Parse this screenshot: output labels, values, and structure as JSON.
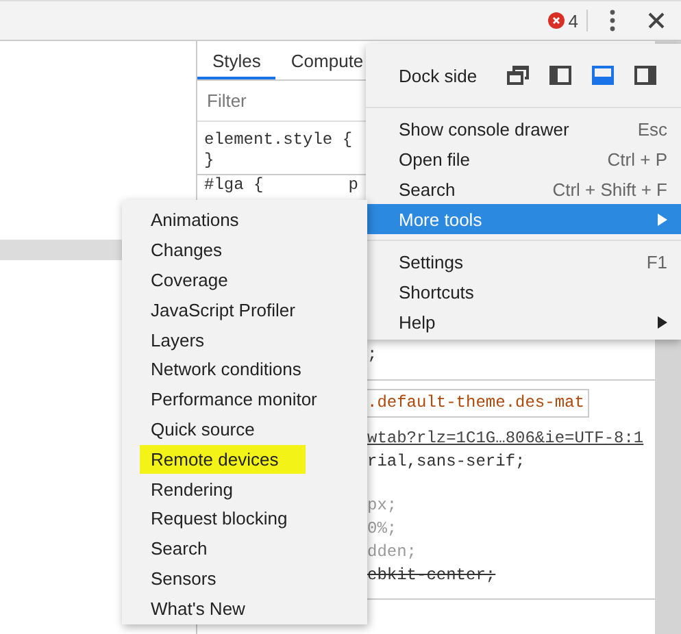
{
  "toolbar": {
    "error_count": "4"
  },
  "styles_panel": {
    "tabs": [
      {
        "label": "Styles",
        "selected": true
      },
      {
        "label": "Compute",
        "selected": false
      }
    ],
    "filter": {
      "placeholder": "Filter"
    },
    "element_style": [
      "element.style {",
      "}"
    ],
    "rule_head": "#lga {",
    "rule_fragment": "p",
    "rule_tail": ";",
    "selector": ".default-theme.des-mat",
    "source_link": "wtab?rlz=1C1G…806&ie=UTF-8:1",
    "declaration": "rial,sans-serif;",
    "overridden_lines": [
      {
        "text": "px;",
        "struck": false
      },
      {
        "text": "0%;",
        "struck": false
      },
      {
        "text": "dden;",
        "struck": false
      },
      {
        "text": "ebkit-center;",
        "struck": true
      }
    ]
  },
  "main_menu": {
    "dock_side": {
      "label": "Dock side",
      "options": [
        {
          "kind": "undock",
          "selected": false
        },
        {
          "kind": "left",
          "selected": false
        },
        {
          "kind": "bottom",
          "selected": true
        },
        {
          "kind": "right",
          "selected": false
        }
      ]
    },
    "groups": [
      [
        {
          "label": "Show console drawer",
          "shortcut": "Esc",
          "submenu": false,
          "selected": false
        },
        {
          "label": "Open file",
          "shortcut": "Ctrl + P",
          "submenu": false,
          "selected": false
        },
        {
          "label": "Search",
          "shortcut": "Ctrl + Shift + F",
          "submenu": false,
          "selected": false
        },
        {
          "label": "More tools",
          "submenu": true,
          "selected": true
        }
      ],
      [
        {
          "label": "Settings",
          "shortcut": "F1",
          "submenu": false,
          "selected": false
        },
        {
          "label": "Shortcuts",
          "submenu": false,
          "selected": false
        },
        {
          "label": "Help",
          "submenu": true,
          "selected": false
        }
      ]
    ]
  },
  "more_tools_menu": [
    {
      "label": "Animations",
      "highlighted": false
    },
    {
      "label": "Changes",
      "highlighted": false
    },
    {
      "label": "Coverage",
      "highlighted": false
    },
    {
      "label": "JavaScript Profiler",
      "highlighted": false
    },
    {
      "label": "Layers",
      "highlighted": false
    },
    {
      "label": "Network conditions",
      "highlighted": false
    },
    {
      "label": "Performance monitor",
      "highlighted": false
    },
    {
      "label": "Quick source",
      "highlighted": false
    },
    {
      "label": "Remote devices",
      "highlighted": true
    },
    {
      "label": "Rendering",
      "highlighted": false
    },
    {
      "label": "Request blocking",
      "highlighted": false
    },
    {
      "label": "Search",
      "highlighted": false
    },
    {
      "label": "Sensors",
      "highlighted": false
    },
    {
      "label": "What's New",
      "highlighted": false
    }
  ]
}
